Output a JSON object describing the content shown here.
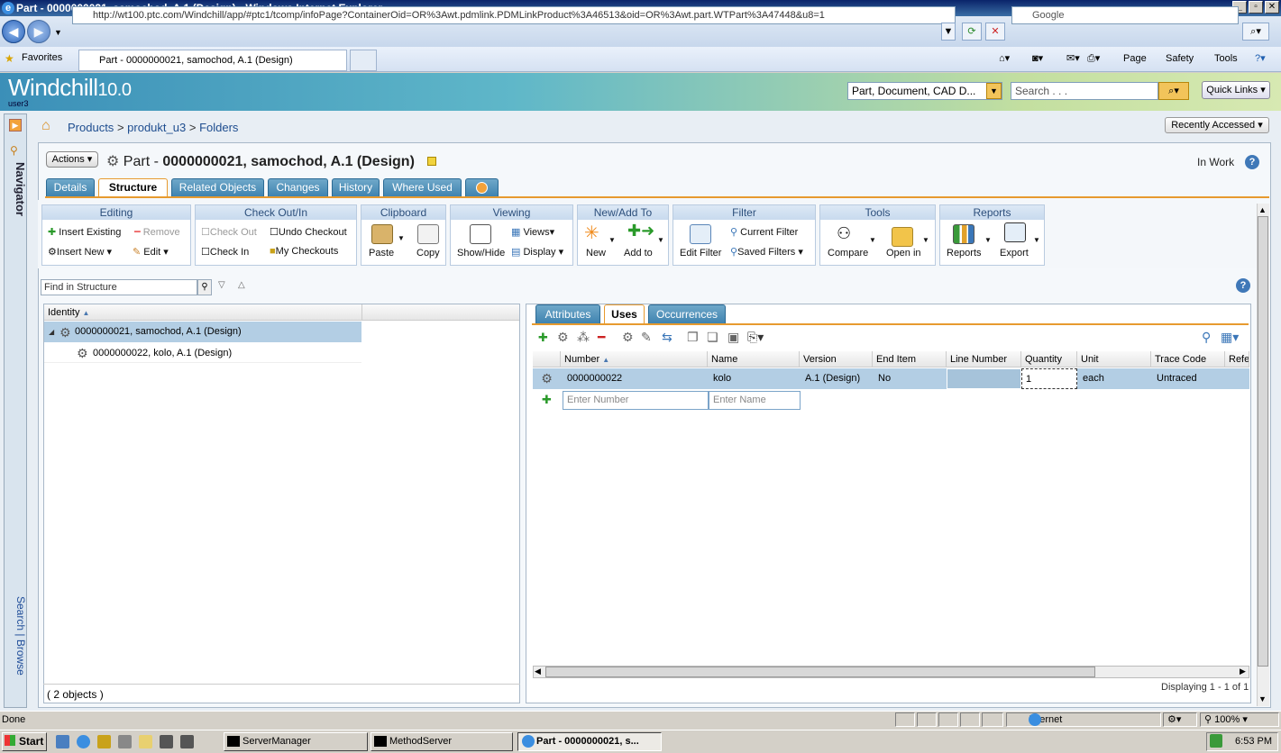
{
  "window": {
    "title": "Part - 0000000021, samochod, A.1 (Design) - Windows Internet Explorer"
  },
  "browser": {
    "address": "http://wt100.ptc.com/Windchill/app/#ptc1/tcomp/infoPage?ContainerOid=OR%3Awt.pdmlink.PDMLinkProduct%3A46513&oid=OR%3Awt.part.WTPart%3A47448&u8=1",
    "search_placeholder": "Google",
    "favorites": "Favorites",
    "tab_title": "Part - 0000000021, samochod, A.1 (Design)",
    "commands": [
      "Page",
      "Safety",
      "Tools"
    ]
  },
  "app": {
    "logo": "Windchill",
    "version": "10.0",
    "user": "user3",
    "type_select": "Part, Document, CAD D...",
    "search_placeholder": "Search . . .",
    "quick_links": "Quick Links",
    "navigator": "Navigator",
    "search_link": "Search",
    "browse_link": "Browse"
  },
  "breadcrumb": {
    "products": "Products",
    "sep": ">",
    "product": "produkt_u3",
    "folders": "Folders"
  },
  "recently_accessed": "Recently Accessed",
  "page": {
    "actions": "Actions",
    "type": "Part -",
    "title": "0000000021, samochod, A.1 (Design)",
    "state": "In Work"
  },
  "tabs": [
    "Details",
    "Structure",
    "Related Objects",
    "Changes",
    "History",
    "Where Used"
  ],
  "toolbar": {
    "editing": {
      "header": "Editing",
      "insert_existing": "Insert Existing",
      "remove": "Remove",
      "insert_new": "Insert New",
      "edit": "Edit"
    },
    "checkout": {
      "header": "Check Out/In",
      "check_out": "Check Out",
      "undo_checkout": "Undo Checkout",
      "check_in": "Check In",
      "my_checkouts": "My Checkouts"
    },
    "clipboard": {
      "header": "Clipboard",
      "paste": "Paste",
      "copy": "Copy"
    },
    "viewing": {
      "header": "Viewing",
      "show_hide": "Show/Hide",
      "views": "Views",
      "display": "Display"
    },
    "newadd": {
      "header": "New/Add To",
      "new": "New",
      "add_to": "Add to"
    },
    "filter": {
      "header": "Filter",
      "edit_filter": "Edit Filter",
      "current_filter": "Current Filter",
      "saved_filters": "Saved Filters"
    },
    "tools": {
      "header": "Tools",
      "compare": "Compare",
      "open_in": "Open in"
    },
    "reports": {
      "header": "Reports",
      "reports": "Reports",
      "export": "Export"
    }
  },
  "find": {
    "placeholder": "Find in Structure"
  },
  "tree": {
    "header": "Identity",
    "rows": [
      "0000000021, samochod, A.1 (Design)",
      "0000000022, kolo, A.1 (Design)"
    ],
    "footer": "( 2 objects )"
  },
  "right_tabs": [
    "Attributes",
    "Uses",
    "Occurrences"
  ],
  "uses_table": {
    "columns": [
      "Number",
      "Name",
      "Version",
      "End Item",
      "Line Number",
      "Quantity",
      "Unit",
      "Trace Code",
      "Refe"
    ],
    "row": {
      "number": "0000000022",
      "name": "kolo",
      "version": "A.1 (Design)",
      "end_item": "No",
      "line_number": "",
      "quantity": "1",
      "unit": "each",
      "trace_code": "Untraced"
    },
    "new_number_placeholder": "Enter Number",
    "new_name_placeholder": "Enter Name",
    "displaying": "Displaying 1 - 1 of 1"
  },
  "status": {
    "text": "Done",
    "zone": "Internet",
    "zoom": "100%"
  },
  "taskbar": {
    "start": "Start",
    "tasks": [
      "ServerManager",
      "MethodServer",
      "Part - 0000000021, s..."
    ],
    "clock": "6:53 PM"
  }
}
